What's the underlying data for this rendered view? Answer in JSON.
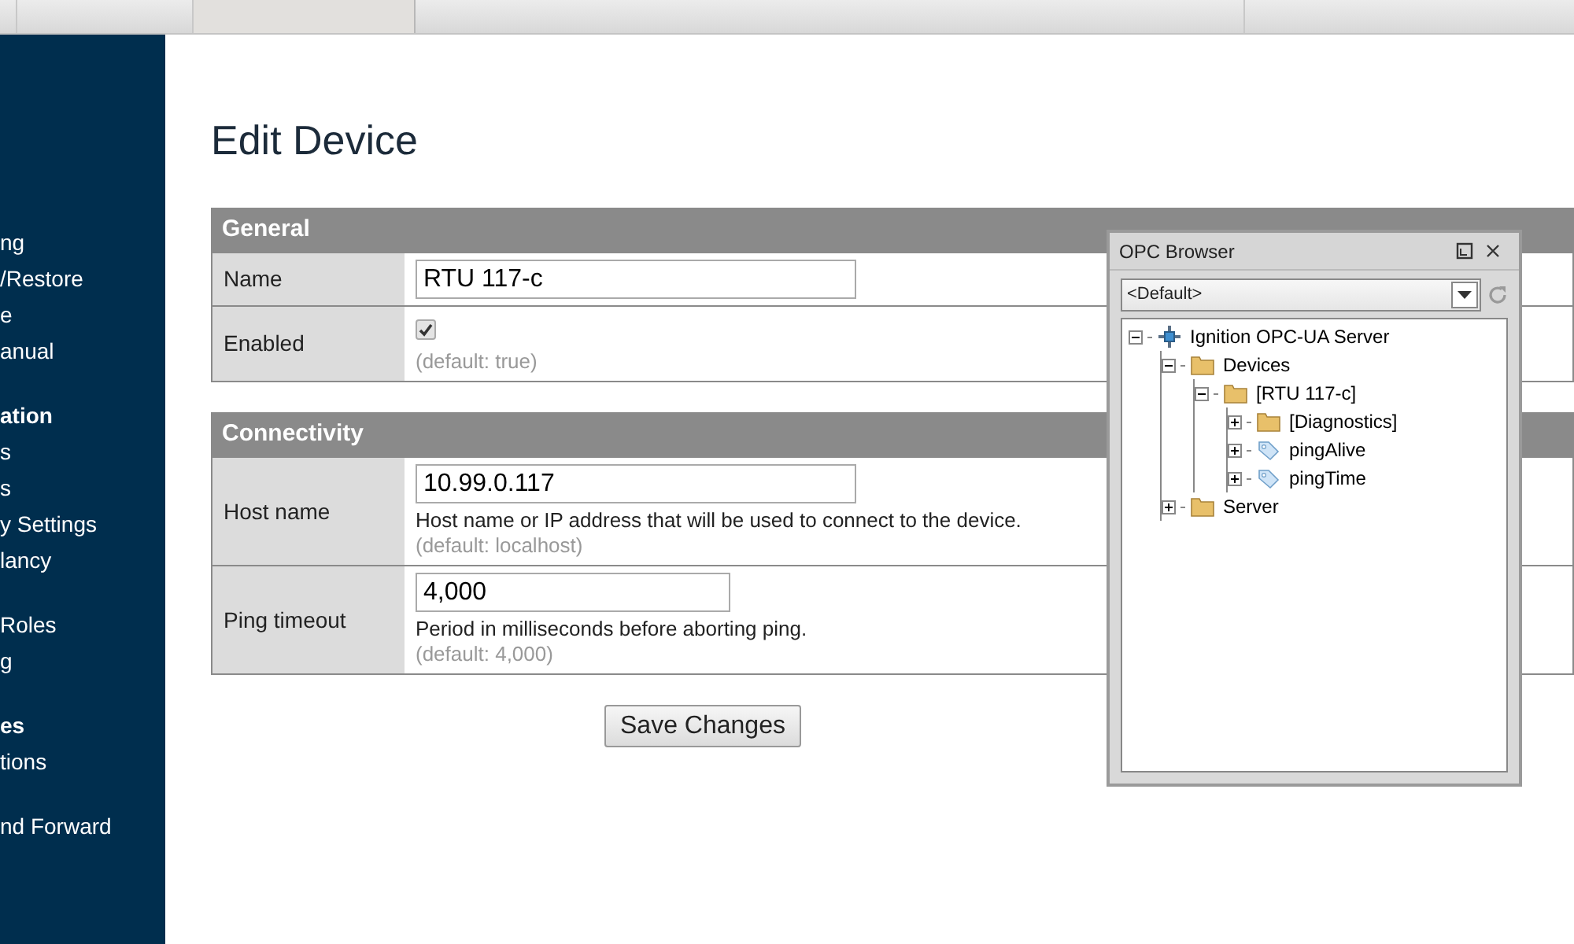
{
  "sidebar": {
    "groups": [
      {
        "items": [
          {
            "label": "ng",
            "kind": "item"
          },
          {
            "label": "/Restore",
            "kind": "item"
          },
          {
            "label": "e",
            "kind": "item"
          },
          {
            "label": "anual",
            "kind": "item"
          }
        ]
      },
      {
        "items": [
          {
            "label": "ation",
            "kind": "header"
          },
          {
            "label": "s",
            "kind": "item"
          },
          {
            "label": "s",
            "kind": "item"
          },
          {
            "label": "y Settings",
            "kind": "item"
          },
          {
            "label": "lancy",
            "kind": "item"
          }
        ]
      },
      {
        "items": [
          {
            "label": "Roles",
            "kind": "item"
          },
          {
            "label": "g",
            "kind": "item"
          }
        ]
      },
      {
        "items": [
          {
            "label": "es",
            "kind": "header"
          },
          {
            "label": "tions",
            "kind": "item"
          }
        ]
      },
      {
        "items": [
          {
            "label": "nd Forward",
            "kind": "item"
          }
        ]
      }
    ]
  },
  "page_title": "Edit Device",
  "sections": [
    {
      "title": "General",
      "rows": [
        {
          "label": "Name",
          "kind": "text",
          "value": "RTU 117-c"
        },
        {
          "label": "Enabled",
          "kind": "checkbox",
          "checked": true,
          "default": "(default: true)"
        }
      ]
    },
    {
      "title": "Connectivity",
      "rows": [
        {
          "label": "Host name",
          "kind": "text",
          "value": "10.99.0.117",
          "description": "Host name or IP address that will be used to connect to the device.",
          "default": "(default: localhost)"
        },
        {
          "label": "Ping timeout",
          "kind": "number",
          "value": "4,000",
          "description": "Period in milliseconds before aborting ping.",
          "default": "(default: 4,000)"
        }
      ]
    }
  ],
  "save_button": "Save Changes",
  "opc_browser": {
    "title": "OPC Browser",
    "server_select": "<Default>",
    "tree": [
      {
        "label": "Ignition OPC-UA Server",
        "kind": "server",
        "expanded": true,
        "children": [
          {
            "label": "Devices",
            "kind": "folder",
            "expanded": true,
            "children": [
              {
                "label": "[RTU 117-c]",
                "kind": "folder",
                "expanded": true,
                "children": [
                  {
                    "label": "[Diagnostics]",
                    "kind": "folder",
                    "expanded": false
                  },
                  {
                    "label": "pingAlive",
                    "kind": "tag",
                    "expanded": false
                  },
                  {
                    "label": "pingTime",
                    "kind": "tag",
                    "expanded": false
                  }
                ]
              }
            ]
          },
          {
            "label": "Server",
            "kind": "folder",
            "expanded": false
          }
        ]
      }
    ]
  }
}
